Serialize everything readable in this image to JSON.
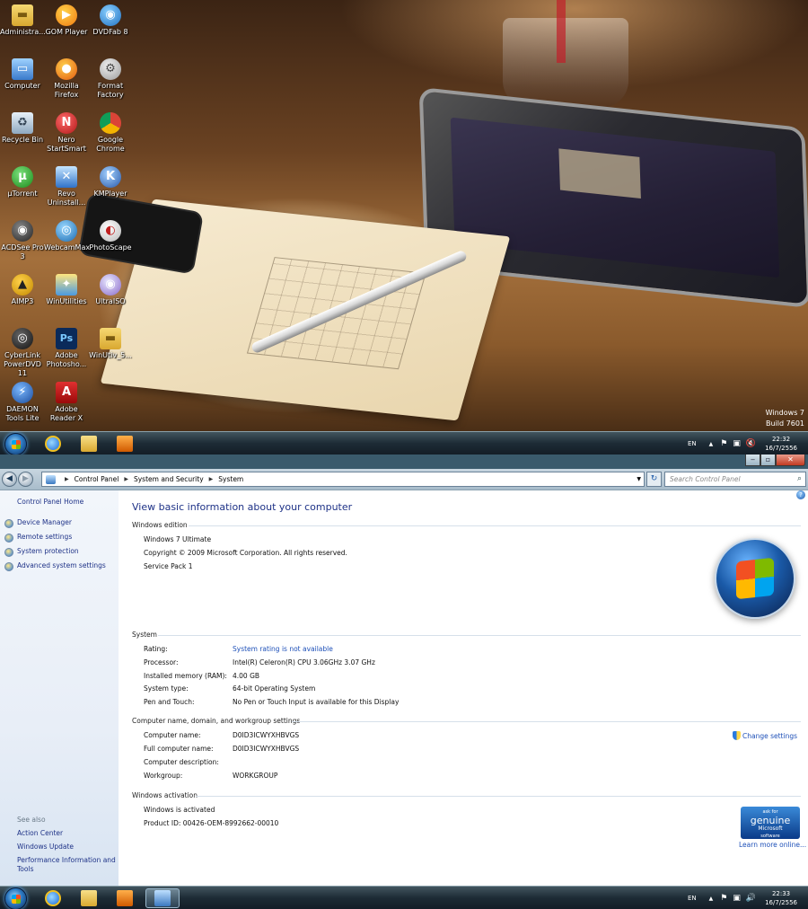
{
  "desktop": {
    "icons": [
      {
        "label": "Administra...",
        "icon": "folder-icon"
      },
      {
        "label": "GOM Player",
        "icon": "gom-player-icon"
      },
      {
        "label": "DVDFab 8",
        "icon": "dvdfab-icon"
      },
      {
        "label": "Computer",
        "icon": "computer-icon"
      },
      {
        "label": "Mozilla Firefox",
        "icon": "firefox-icon"
      },
      {
        "label": "Format Factory",
        "icon": "format-factory-icon"
      },
      {
        "label": "Recycle Bin",
        "icon": "recycle-bin-icon"
      },
      {
        "label": "Nero StartSmart",
        "icon": "nero-icon"
      },
      {
        "label": "Google Chrome",
        "icon": "chrome-icon"
      },
      {
        "label": "µTorrent",
        "icon": "utorrent-icon"
      },
      {
        "label": "Revo Uninstall...",
        "icon": "revo-uninstaller-icon"
      },
      {
        "label": "KMPlayer",
        "icon": "kmplayer-icon"
      },
      {
        "label": "ACDSee Pro 3",
        "icon": "acdsee-icon"
      },
      {
        "label": "WebcamMax",
        "icon": "webcammax-icon"
      },
      {
        "label": "PhotoScape",
        "icon": "photoscape-icon"
      },
      {
        "label": "AIMP3",
        "icon": "aimp-icon"
      },
      {
        "label": "WinUtilities",
        "icon": "winutilities-icon"
      },
      {
        "label": "UltraISO",
        "icon": "ultraiso-icon"
      },
      {
        "label": "CyberLink PowerDVD 11",
        "icon": "powerdvd-icon"
      },
      {
        "label": "Adobe Photosho...",
        "icon": "photoshop-icon"
      },
      {
        "label": "WinUtiv_5...",
        "icon": "folder-icon"
      },
      {
        "label": "DAEMON Tools Lite",
        "icon": "daemon-tools-icon"
      },
      {
        "label": "Adobe Reader X",
        "icon": "adobe-reader-icon"
      }
    ],
    "watermark_line1": "Windows 7",
    "watermark_line2": "Build 7601"
  },
  "taskbar_top": {
    "lang": "EN",
    "time": "22:32",
    "date": "16/7/2556"
  },
  "taskbar_bottom": {
    "lang": "EN",
    "time": "22:33",
    "date": "16/7/2556"
  },
  "window": {
    "breadcrumb": [
      "Control Panel",
      "System and Security",
      "System"
    ],
    "search_placeholder": "Search Control Panel",
    "left_pane": {
      "home": "Control Panel Home",
      "links": [
        "Device Manager",
        "Remote settings",
        "System protection",
        "Advanced system settings"
      ],
      "see_also_heading": "See also",
      "see_also": [
        "Action Center",
        "Windows Update",
        "Performance Information and Tools"
      ]
    },
    "page_title": "View basic information about your computer",
    "edition": {
      "heading": "Windows edition",
      "name": "Windows 7 Ultimate",
      "copyright": "Copyright © 2009 Microsoft Corporation.  All rights reserved.",
      "service_pack": "Service Pack 1"
    },
    "system": {
      "heading": "System",
      "rows": [
        {
          "label": "Rating:",
          "value": "System rating is not available"
        },
        {
          "label": "Processor:",
          "value": "Intel(R) Celeron(R) CPU 3.06GHz   3.07 GHz"
        },
        {
          "label": "Installed memory (RAM):",
          "value": "4.00 GB"
        },
        {
          "label": "System type:",
          "value": "64-bit Operating System"
        },
        {
          "label": "Pen and Touch:",
          "value": "No Pen or Touch Input is available for this Display"
        }
      ]
    },
    "computer_name": {
      "heading": "Computer name, domain, and workgroup settings",
      "change_settings": "Change settings",
      "rows": [
        {
          "label": "Computer name:",
          "value": "D0ID3ICWYXHBVGS"
        },
        {
          "label": "Full computer name:",
          "value": "D0ID3ICWYXHBVGS"
        },
        {
          "label": "Computer description:",
          "value": ""
        },
        {
          "label": "Workgroup:",
          "value": "WORKGROUP"
        }
      ]
    },
    "activation": {
      "heading": "Windows activation",
      "status": "Windows is activated",
      "product_id": "Product ID: 00426-OEM-8992662-00010",
      "genuine_line1": "ask for",
      "genuine_line2": "genuine",
      "genuine_line3": "Microsoft",
      "genuine_line4": "software",
      "learn_more": "Learn more online..."
    }
  }
}
